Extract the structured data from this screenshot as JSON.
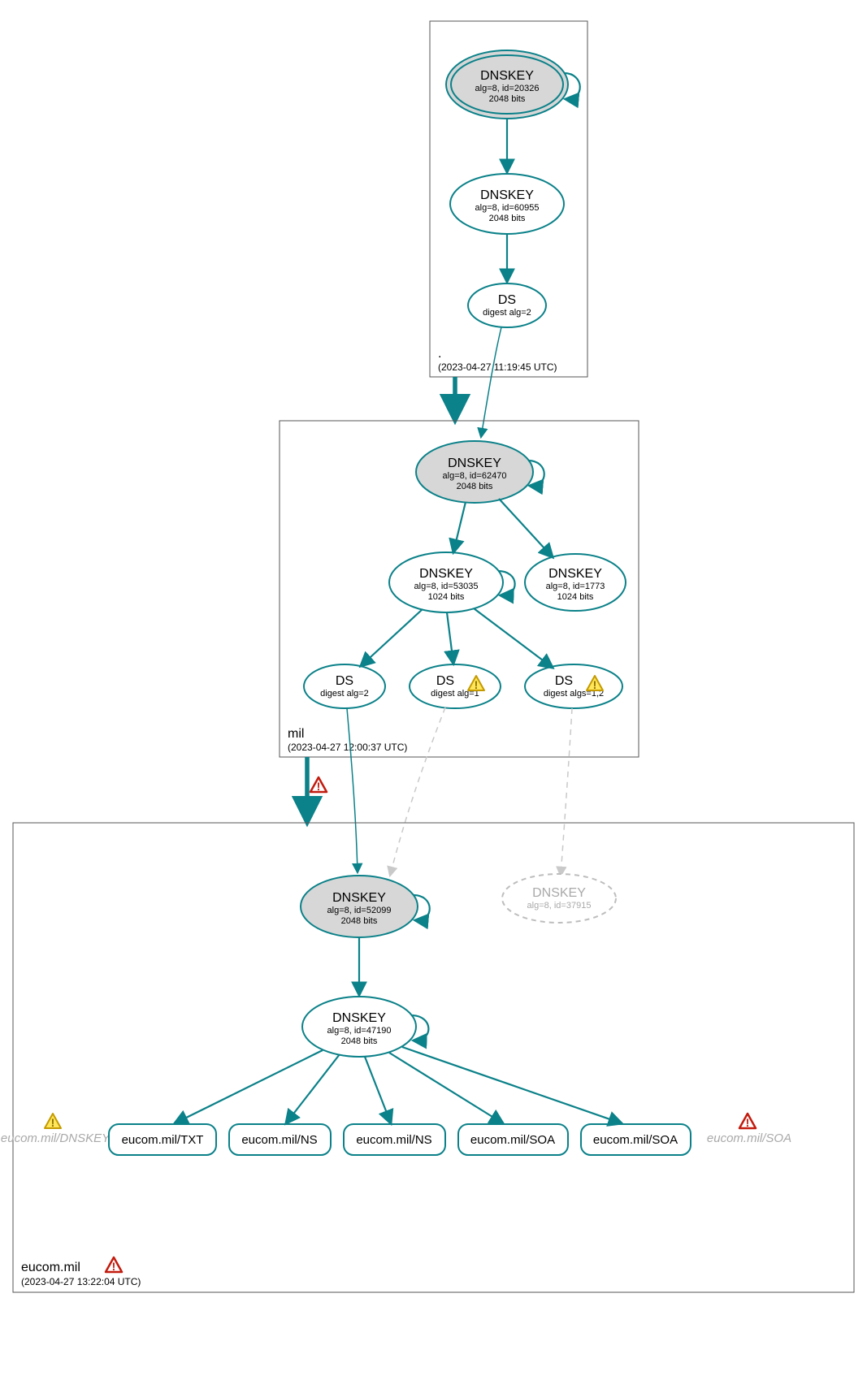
{
  "zones": {
    "root": {
      "name": ".",
      "timestamp": "(2023-04-27 11:19:45 UTC)"
    },
    "mil": {
      "name": "mil",
      "timestamp": "(2023-04-27 12:00:37 UTC)"
    },
    "eucom": {
      "name": "eucom.mil",
      "timestamp": "(2023-04-27 13:22:04 UTC)"
    }
  },
  "nodes": {
    "root_ksk": {
      "title": "DNSKEY",
      "sub1": "alg=8, id=20326",
      "sub2": "2048 bits"
    },
    "root_zsk": {
      "title": "DNSKEY",
      "sub1": "alg=8, id=60955",
      "sub2": "2048 bits"
    },
    "root_ds": {
      "title": "DS",
      "sub1": "digest alg=2"
    },
    "mil_ksk": {
      "title": "DNSKEY",
      "sub1": "alg=8, id=62470",
      "sub2": "2048 bits"
    },
    "mil_zsk": {
      "title": "DNSKEY",
      "sub1": "alg=8, id=53035",
      "sub2": "1024 bits"
    },
    "mil_zsk2": {
      "title": "DNSKEY",
      "sub1": "alg=8, id=1773",
      "sub2": "1024 bits"
    },
    "mil_ds1": {
      "title": "DS",
      "sub1": "digest alg=2"
    },
    "mil_ds2": {
      "title": "DS",
      "sub1": "digest alg=1"
    },
    "mil_ds3": {
      "title": "DS",
      "sub1": "digest algs=1,2"
    },
    "eucom_ksk": {
      "title": "DNSKEY",
      "sub1": "alg=8, id=52099",
      "sub2": "2048 bits"
    },
    "eucom_ghost": {
      "title": "DNSKEY",
      "sub1": "alg=8, id=37915"
    },
    "eucom_zsk": {
      "title": "DNSKEY",
      "sub1": "alg=8, id=47190",
      "sub2": "2048 bits"
    }
  },
  "rrsets": {
    "r1": "eucom.mil/DNSKEY",
    "r2": "eucom.mil/TXT",
    "r3": "eucom.mil/NS",
    "r4": "eucom.mil/NS",
    "r5": "eucom.mil/SOA",
    "r6": "eucom.mil/SOA",
    "r7": "eucom.mil/SOA"
  },
  "chart_data": {
    "type": "graph",
    "description": "DNSSEC authentication chain / DNSViz-style delegation graph",
    "zones": [
      {
        "id": "root",
        "label": ".",
        "timestamp": "2023-04-27 11:19:45 UTC"
      },
      {
        "id": "mil",
        "label": "mil",
        "timestamp": "2023-04-27 12:00:37 UTC",
        "status": "ok"
      },
      {
        "id": "eucom",
        "label": "eucom.mil",
        "timestamp": "2023-04-27 13:22:04 UTC",
        "status": "error"
      }
    ],
    "nodes": [
      {
        "id": "root_ksk",
        "zone": "root",
        "type": "DNSKEY",
        "alg": 8,
        "key_id": 20326,
        "bits": 2048,
        "role": "KSK",
        "trust_anchor": true
      },
      {
        "id": "root_zsk",
        "zone": "root",
        "type": "DNSKEY",
        "alg": 8,
        "key_id": 60955,
        "bits": 2048,
        "role": "ZSK"
      },
      {
        "id": "root_ds",
        "zone": "root",
        "type": "DS",
        "digest_algs": [
          2
        ]
      },
      {
        "id": "mil_ksk",
        "zone": "mil",
        "type": "DNSKEY",
        "alg": 8,
        "key_id": 62470,
        "bits": 2048,
        "role": "KSK"
      },
      {
        "id": "mil_zsk",
        "zone": "mil",
        "type": "DNSKEY",
        "alg": 8,
        "key_id": 53035,
        "bits": 1024,
        "role": "ZSK"
      },
      {
        "id": "mil_zsk2",
        "zone": "mil",
        "type": "DNSKEY",
        "alg": 8,
        "key_id": 1773,
        "bits": 1024,
        "role": "ZSK"
      },
      {
        "id": "mil_ds1",
        "zone": "mil",
        "type": "DS",
        "digest_algs": [
          2
        ]
      },
      {
        "id": "mil_ds2",
        "zone": "mil",
        "type": "DS",
        "digest_algs": [
          1
        ],
        "status": "warning"
      },
      {
        "id": "mil_ds3",
        "zone": "mil",
        "type": "DS",
        "digest_algs": [
          1,
          2
        ],
        "status": "warning"
      },
      {
        "id": "eucom_ksk",
        "zone": "eucom",
        "type": "DNSKEY",
        "alg": 8,
        "key_id": 52099,
        "bits": 2048,
        "role": "KSK"
      },
      {
        "id": "eucom_ghost",
        "zone": "eucom",
        "type": "DNSKEY",
        "alg": 8,
        "key_id": 37915,
        "role": "unresolved",
        "status": "missing"
      },
      {
        "id": "eucom_zsk",
        "zone": "eucom",
        "type": "DNSKEY",
        "alg": 8,
        "key_id": 47190,
        "bits": 2048,
        "role": "ZSK"
      },
      {
        "id": "rr_dnskey",
        "zone": "eucom",
        "type": "RRset",
        "name": "eucom.mil/DNSKEY",
        "status": "warning"
      },
      {
        "id": "rr_txt",
        "zone": "eucom",
        "type": "RRset",
        "name": "eucom.mil/TXT"
      },
      {
        "id": "rr_ns1",
        "zone": "eucom",
        "type": "RRset",
        "name": "eucom.mil/NS"
      },
      {
        "id": "rr_ns2",
        "zone": "eucom",
        "type": "RRset",
        "name": "eucom.mil/NS"
      },
      {
        "id": "rr_soa1",
        "zone": "eucom",
        "type": "RRset",
        "name": "eucom.mil/SOA"
      },
      {
        "id": "rr_soa2",
        "zone": "eucom",
        "type": "RRset",
        "name": "eucom.mil/SOA"
      },
      {
        "id": "rr_soa3",
        "zone": "eucom",
        "type": "RRset",
        "name": "eucom.mil/SOA",
        "status": "error"
      }
    ],
    "edges": [
      {
        "from": "root_ksk",
        "to": "root_ksk",
        "kind": "self-sig"
      },
      {
        "from": "root_ksk",
        "to": "root_zsk",
        "kind": "sig"
      },
      {
        "from": "root_zsk",
        "to": "root_ds",
        "kind": "sig"
      },
      {
        "from": "root",
        "to": "mil",
        "kind": "delegation",
        "weight": "bold"
      },
      {
        "from": "root_ds",
        "to": "mil_ksk",
        "kind": "ds-match"
      },
      {
        "from": "mil_ksk",
        "to": "mil_ksk",
        "kind": "self-sig"
      },
      {
        "from": "mil_ksk",
        "to": "mil_zsk",
        "kind": "sig"
      },
      {
        "from": "mil_ksk",
        "to": "mil_zsk2",
        "kind": "sig"
      },
      {
        "from": "mil_zsk",
        "to": "mil_zsk",
        "kind": "self-sig"
      },
      {
        "from": "mil_zsk",
        "to": "mil_ds1",
        "kind": "sig"
      },
      {
        "from": "mil_zsk",
        "to": "mil_ds2",
        "kind": "sig"
      },
      {
        "from": "mil_zsk",
        "to": "mil_ds3",
        "kind": "sig"
      },
      {
        "from": "mil",
        "to": "eucom",
        "kind": "delegation",
        "weight": "bold",
        "status": "error"
      },
      {
        "from": "mil_ds1",
        "to": "eucom_ksk",
        "kind": "ds-match"
      },
      {
        "from": "mil_ds2",
        "to": "eucom_ksk",
        "kind": "ds-match",
        "status": "faded"
      },
      {
        "from": "mil_ds3",
        "to": "eucom_ghost",
        "kind": "ds-match",
        "status": "faded"
      },
      {
        "from": "eucom_ksk",
        "to": "eucom_ksk",
        "kind": "self-sig"
      },
      {
        "from": "eucom_ksk",
        "to": "eucom_zsk",
        "kind": "sig"
      },
      {
        "from": "eucom_zsk",
        "to": "eucom_zsk",
        "kind": "self-sig"
      },
      {
        "from": "eucom_zsk",
        "to": "rr_txt",
        "kind": "sig"
      },
      {
        "from": "eucom_zsk",
        "to": "rr_ns1",
        "kind": "sig"
      },
      {
        "from": "eucom_zsk",
        "to": "rr_ns2",
        "kind": "sig"
      },
      {
        "from": "eucom_zsk",
        "to": "rr_soa1",
        "kind": "sig"
      },
      {
        "from": "eucom_zsk",
        "to": "rr_soa2",
        "kind": "sig"
      }
    ]
  }
}
